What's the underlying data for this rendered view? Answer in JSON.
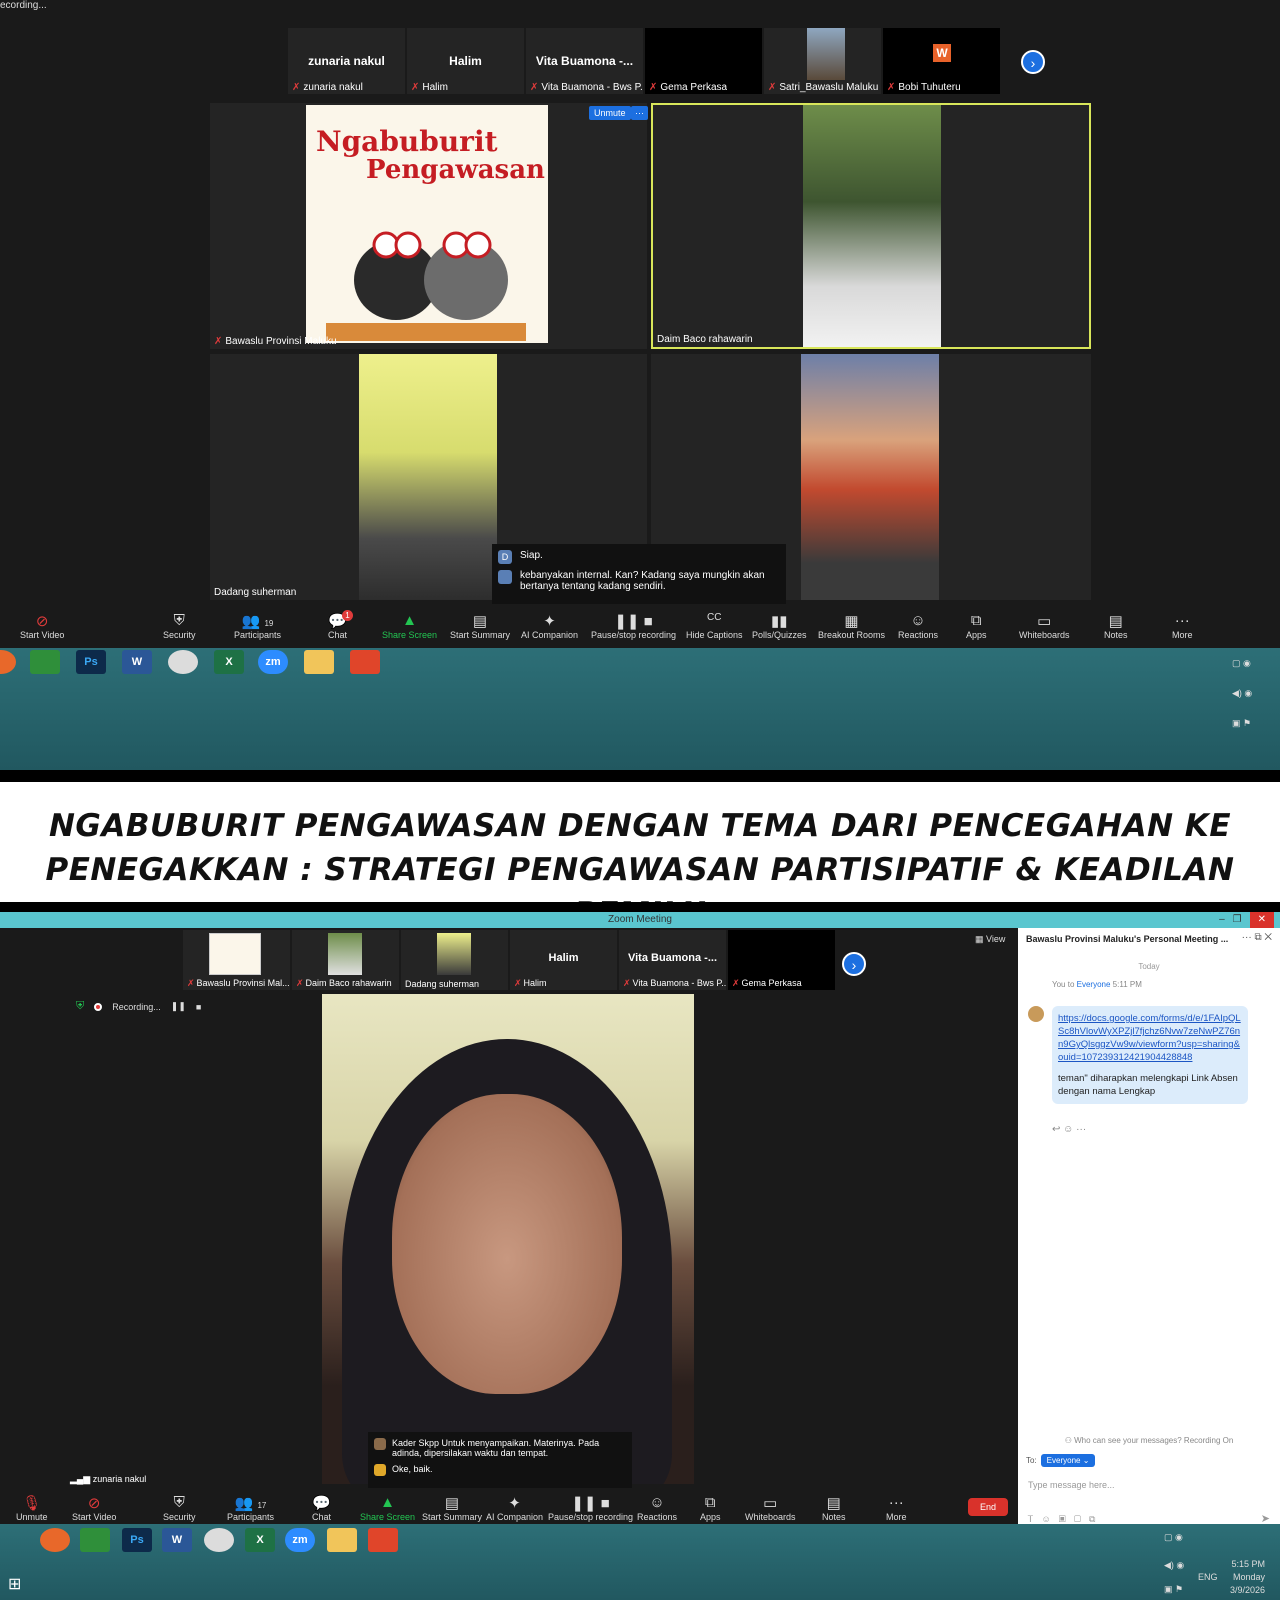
{
  "top": {
    "recording_corner": "ecording...",
    "strip": [
      {
        "name": "zunaria nakul",
        "label": "zunaria nakul",
        "muted": true
      },
      {
        "name": "Halim",
        "label": "Halim",
        "muted": true
      },
      {
        "name": "Vita Buamona -...",
        "label": "Vita Buamona - Bws P...",
        "muted": true
      },
      {
        "name": "",
        "label": "Gema Perkasa",
        "muted": true
      },
      {
        "name": "",
        "label": "Satri_Bawaslu Maluku",
        "muted": true
      },
      {
        "name": "",
        "label": "Bobi Tuhuteru",
        "muted": true
      }
    ],
    "tiles": [
      {
        "label": "Bawaslu Provinsi Maluku"
      },
      {
        "label": "Daim Baco rahawarin"
      },
      {
        "label": "Dadang suherman"
      }
    ],
    "poster": {
      "line1": "Ngabuburit",
      "line2": "Pengawasan"
    },
    "unmute_label": "Unmute",
    "unmute_more": "···",
    "chat": [
      {
        "avatar": "D",
        "text": "Siap."
      },
      {
        "avatar": "",
        "text": "kebanyakan internal. Kan? Kadang saya mungkin akan bertanya tentang kadang sendiri."
      }
    ],
    "toolbar": [
      {
        "label": "Start Video",
        "icon": "⊘"
      },
      {
        "label": "Security",
        "icon": "⛨"
      },
      {
        "label": "Participants",
        "icon": "👥",
        "count": "19"
      },
      {
        "label": "Chat",
        "icon": "💬",
        "badge": "1"
      },
      {
        "label": "Share Screen",
        "icon": "▲"
      },
      {
        "label": "Start Summary",
        "icon": "▤"
      },
      {
        "label": "AI Companion",
        "icon": "✦"
      },
      {
        "label": "Pause/stop recording",
        "icon": "❚❚ ■"
      },
      {
        "label": "Hide Captions",
        "icon": "CC"
      },
      {
        "label": "Polls/Quizzes",
        "icon": "▮▮"
      },
      {
        "label": "Breakout Rooms",
        "icon": "▦"
      },
      {
        "label": "Reactions",
        "icon": "☺"
      },
      {
        "label": "Apps",
        "icon": "⧉"
      },
      {
        "label": "Whiteboards",
        "icon": "▭"
      },
      {
        "label": "Notes",
        "icon": "▤"
      },
      {
        "label": "More",
        "icon": "···"
      }
    ],
    "taskbar": [
      "",
      "",
      "Ps",
      "W",
      "",
      "X",
      "zm",
      "",
      ""
    ]
  },
  "banner": {
    "line1": "NGABUBURIT PENGAWASAN DENGAN TEMA DARI PENCEGAHAN KE",
    "line2": "PENEGAKKAN : STRATEGI PENGAWASAN PARTISIPATIF & KEADILAN PEMILU"
  },
  "bottom": {
    "window_title": "Zoom Meeting",
    "strip": [
      {
        "name": "",
        "label": "Bawaslu Provinsi Mal..."
      },
      {
        "name": "",
        "label": "Daim Baco rahawarin"
      },
      {
        "name": "",
        "label": "Dadang suherman"
      },
      {
        "name": "Halim",
        "label": "Halim"
      },
      {
        "name": "Vita Buamona -...",
        "label": "Vita Buamona - Bws P..."
      },
      {
        "name": "",
        "label": "Gema Perkasa"
      }
    ],
    "view_label": "View",
    "recording_label": "Recording...",
    "chat_overlay": [
      {
        "text": "Kader Skpp Untuk menyampaikan. Materinya. Pada adinda, dipersilakan waktu dan tempat."
      },
      {
        "text": "Oke, baik."
      }
    ],
    "speaker_label": "zunaria nakul",
    "toolbar": [
      {
        "label": "Unmute",
        "icon": "🎙"
      },
      {
        "label": "Start Video",
        "icon": "⊘"
      },
      {
        "label": "Security",
        "icon": "⛨"
      },
      {
        "label": "Participants",
        "icon": "👥",
        "count": "17"
      },
      {
        "label": "Chat",
        "icon": "💬"
      },
      {
        "label": "Share Screen",
        "icon": "▲"
      },
      {
        "label": "Start Summary",
        "icon": "▤"
      },
      {
        "label": "AI Companion",
        "icon": "✦"
      },
      {
        "label": "Pause/stop recording",
        "icon": "❚❚ ■"
      },
      {
        "label": "Reactions",
        "icon": "☺"
      },
      {
        "label": "Apps",
        "icon": "⧉"
      },
      {
        "label": "Whiteboards",
        "icon": "▭"
      },
      {
        "label": "Notes",
        "icon": "▤"
      },
      {
        "label": "More",
        "icon": "···"
      }
    ],
    "end_label": "End",
    "side": {
      "header": "Bawaslu Provinsi Maluku's Personal Meeting ...",
      "today": "Today",
      "from": "You to",
      "to_target": "Everyone",
      "time": "5:11 PM",
      "link": "https://docs.google.com/forms/d/e/1FAIpQLSc8hVlovWyXPZjl7fjchz6Nvw7zeNwPZ76nn9GyQlsggzVw9w/viewform?usp=sharing&ouid=107239312421904428848",
      "message": "teman\" diharapkan melengkapi Link Absen dengan nama Lengkap",
      "who_can_see": "Who can see your messages? Recording On",
      "to_label": "To:",
      "to_pill": "Everyone",
      "placeholder": "Type message here..."
    },
    "clock": {
      "time": "5:15 PM",
      "day": "Monday",
      "date": "3/9/2026",
      "lang": "ENG"
    }
  }
}
